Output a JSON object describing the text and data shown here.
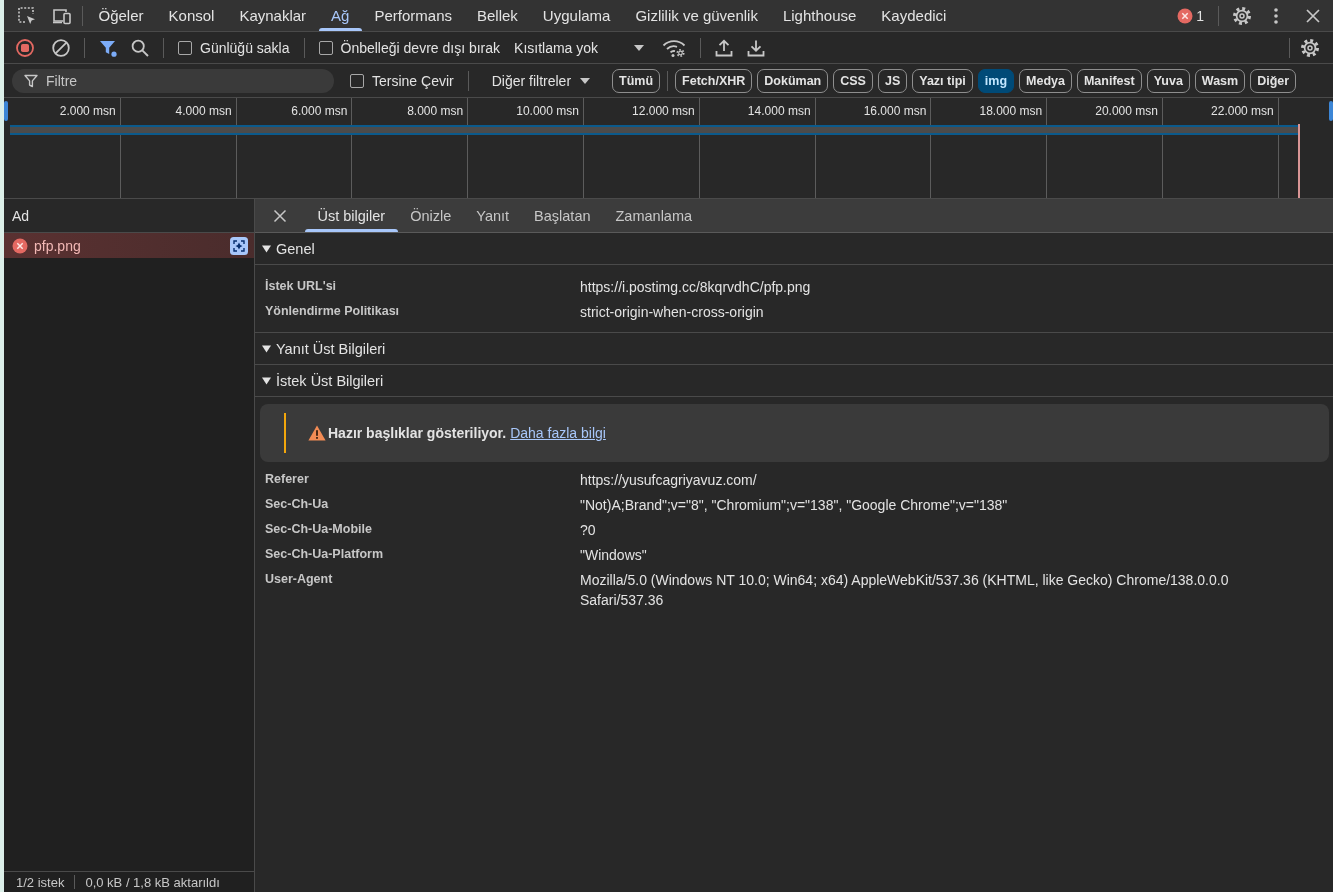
{
  "tab_bar": {
    "tabs": [
      {
        "label": "Öğeler",
        "selected": false
      },
      {
        "label": "Konsol",
        "selected": false
      },
      {
        "label": "Kaynaklar",
        "selected": false
      },
      {
        "label": "Ağ",
        "selected": true
      },
      {
        "label": "Performans",
        "selected": false
      },
      {
        "label": "Bellek",
        "selected": false
      },
      {
        "label": "Uygulama",
        "selected": false
      },
      {
        "label": "Gizlilik ve güvenlik",
        "selected": false
      },
      {
        "label": "Lighthouse",
        "selected": false
      },
      {
        "label": "Kaydedici",
        "selected": false
      }
    ],
    "error_count": "1"
  },
  "toolbar": {
    "recording": true,
    "filter_on": true,
    "checkboxes": [
      {
        "label": "Günlüğü sakla",
        "checked": false
      },
      {
        "label": "Önbelleği devre dışı bırak",
        "checked": false
      }
    ],
    "throttling": "Kısıtlama yok"
  },
  "filter_bar": {
    "placeholder": "Filtre",
    "invert": {
      "label": "Tersine Çevir",
      "checked": false
    },
    "more_filters": "Diğer filtreler",
    "types": [
      {
        "label": "Tümü",
        "selected": false
      },
      {
        "label": "Fetch/XHR",
        "selected": false
      },
      {
        "label": "Doküman",
        "selected": false
      },
      {
        "label": "CSS",
        "selected": false
      },
      {
        "label": "JS",
        "selected": false
      },
      {
        "label": "Yazı tipi",
        "selected": false
      },
      {
        "label": "img",
        "selected": true
      },
      {
        "label": "Medya",
        "selected": false
      },
      {
        "label": "Manifest",
        "selected": false
      },
      {
        "label": "Yuva",
        "selected": false
      },
      {
        "label": "Wasm",
        "selected": false
      },
      {
        "label": "Diğer",
        "selected": false
      }
    ]
  },
  "overview": {
    "ticks": [
      "2.000 msn",
      "4.000 msn",
      "6.000 msn",
      "8.000 msn",
      "10.000 msn",
      "12.000 msn",
      "14.000 msn",
      "16.000 msn",
      "18.000 msn",
      "20.000 msn",
      "22.000 msn"
    ]
  },
  "requests": {
    "column": "Ad",
    "rows": [
      {
        "name": "pfp.png",
        "failed": true,
        "selected": true
      }
    ],
    "count": "1/2 istek",
    "transferred": "0,0 kB / 1,8 kB aktarıldı"
  },
  "details": {
    "tabs": [
      {
        "label": "Üst bilgiler",
        "selected": true
      },
      {
        "label": "Önizle",
        "selected": false
      },
      {
        "label": "Yanıt",
        "selected": false
      },
      {
        "label": "Başlatan",
        "selected": false
      },
      {
        "label": "Zamanlama",
        "selected": false
      }
    ],
    "sections": [
      {
        "title": "Genel",
        "expanded": true,
        "rows": [
          {
            "name": "İstek URL'si",
            "value": "https://i.postimg.cc/8kqrvdhC/pfp.png"
          },
          {
            "name": "Yönlendirme Politikası",
            "value": "strict-origin-when-cross-origin"
          }
        ]
      },
      {
        "title": "Yanıt Üst Bilgileri",
        "expanded": true
      },
      {
        "title": "İstek Üst Bilgileri",
        "expanded": true,
        "notice": {
          "message": "Hazır başlıklar gösteriliyor.",
          "link": "Daha fazla bilgi"
        },
        "rows": [
          {
            "name": "Referer",
            "value": "https://yusufcagriyavuz.com/"
          },
          {
            "name": "Sec-Ch-Ua",
            "value": "\"Not)A;Brand\";v=\"8\", \"Chromium\";v=\"138\", \"Google Chrome\";v=\"138\""
          },
          {
            "name": "Sec-Ch-Ua-Mobile",
            "value": "?0"
          },
          {
            "name": "Sec-Ch-Ua-Platform",
            "value": "\"Windows\""
          },
          {
            "name": "User-Agent",
            "value": "Mozilla/5.0 (Windows NT 10.0; Win64; x64) AppleWebKit/537.36 (KHTML, like Gecko) Chrome/138.0.0.0 Safari/537.36"
          }
        ]
      }
    ]
  }
}
